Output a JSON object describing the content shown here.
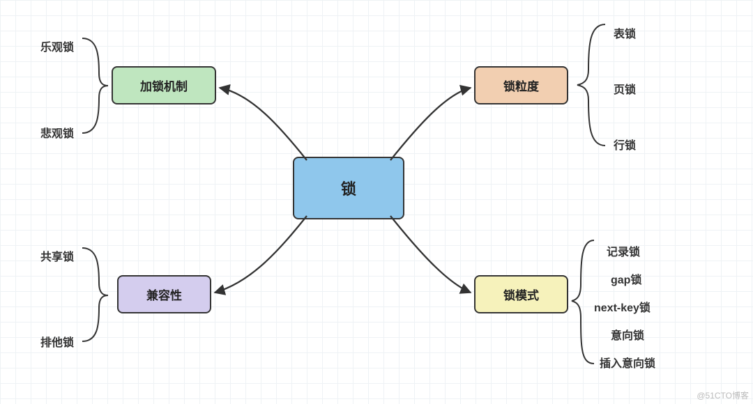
{
  "chart_data": {
    "type": "mindmap",
    "title": "",
    "root": {
      "label": "锁"
    },
    "branches": [
      {
        "label": "加锁机制",
        "color": "#bfe6bf",
        "children": [
          "乐观锁",
          "悲观锁"
        ]
      },
      {
        "label": "锁粒度",
        "color": "#f2cfb1",
        "children": [
          "表锁",
          "页锁",
          "行锁"
        ]
      },
      {
        "label": "兼容性",
        "color": "#d4cdee",
        "children": [
          "共享锁",
          "排他锁"
        ]
      },
      {
        "label": "锁模式",
        "color": "#f6f2bb",
        "children": [
          "记录锁",
          "gap锁",
          "next-key锁",
          "意向锁",
          "插入意向锁"
        ]
      }
    ]
  },
  "center": {
    "label": "锁"
  },
  "nodes": {
    "locking_mechanism": "加锁机制",
    "granularity": "锁粒度",
    "compatibility": "兼容性",
    "mode": "锁模式"
  },
  "leaves": {
    "optimistic": "乐观锁",
    "pessimistic": "悲观锁",
    "table_lock": "表锁",
    "page_lock": "页锁",
    "row_lock": "行锁",
    "shared_lock": "共享锁",
    "exclusive_lock": "排他锁",
    "record_lock": "记录锁",
    "gap_lock": "gap锁",
    "next_key_lock": "next-key锁",
    "intention_lock": "意向锁",
    "insert_intention_lock": "插入意向锁"
  },
  "watermark": "@51CTO博客"
}
